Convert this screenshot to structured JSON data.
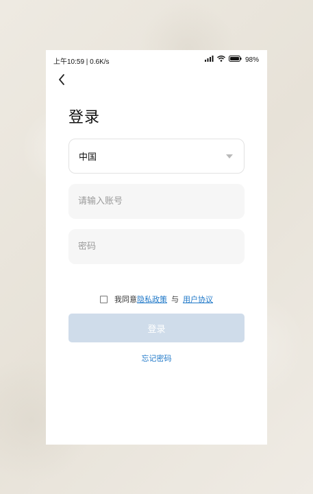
{
  "status_bar": {
    "time_speed": "上午10:59 | 0.6K/s",
    "battery": "98%",
    "icons": [
      "signal-icon",
      "wifi-icon",
      "battery-icon"
    ]
  },
  "header": {
    "back_icon": "chevron-left-icon",
    "title": "登录"
  },
  "form": {
    "country": "中国",
    "account_placeholder": "请输入账号",
    "password_placeholder": "密码"
  },
  "agreement": {
    "prefix": "我同意",
    "privacy_link": "隐私政策",
    "and": "与",
    "terms_link": "用户协议",
    "checked": false
  },
  "actions": {
    "login_label": "登录",
    "forgot_label": "忘记密码"
  },
  "colors": {
    "link": "#1f78c8",
    "login_button_disabled": "#cfdcea",
    "input_bg": "#f6f6f6",
    "background": "#ece8e0"
  }
}
